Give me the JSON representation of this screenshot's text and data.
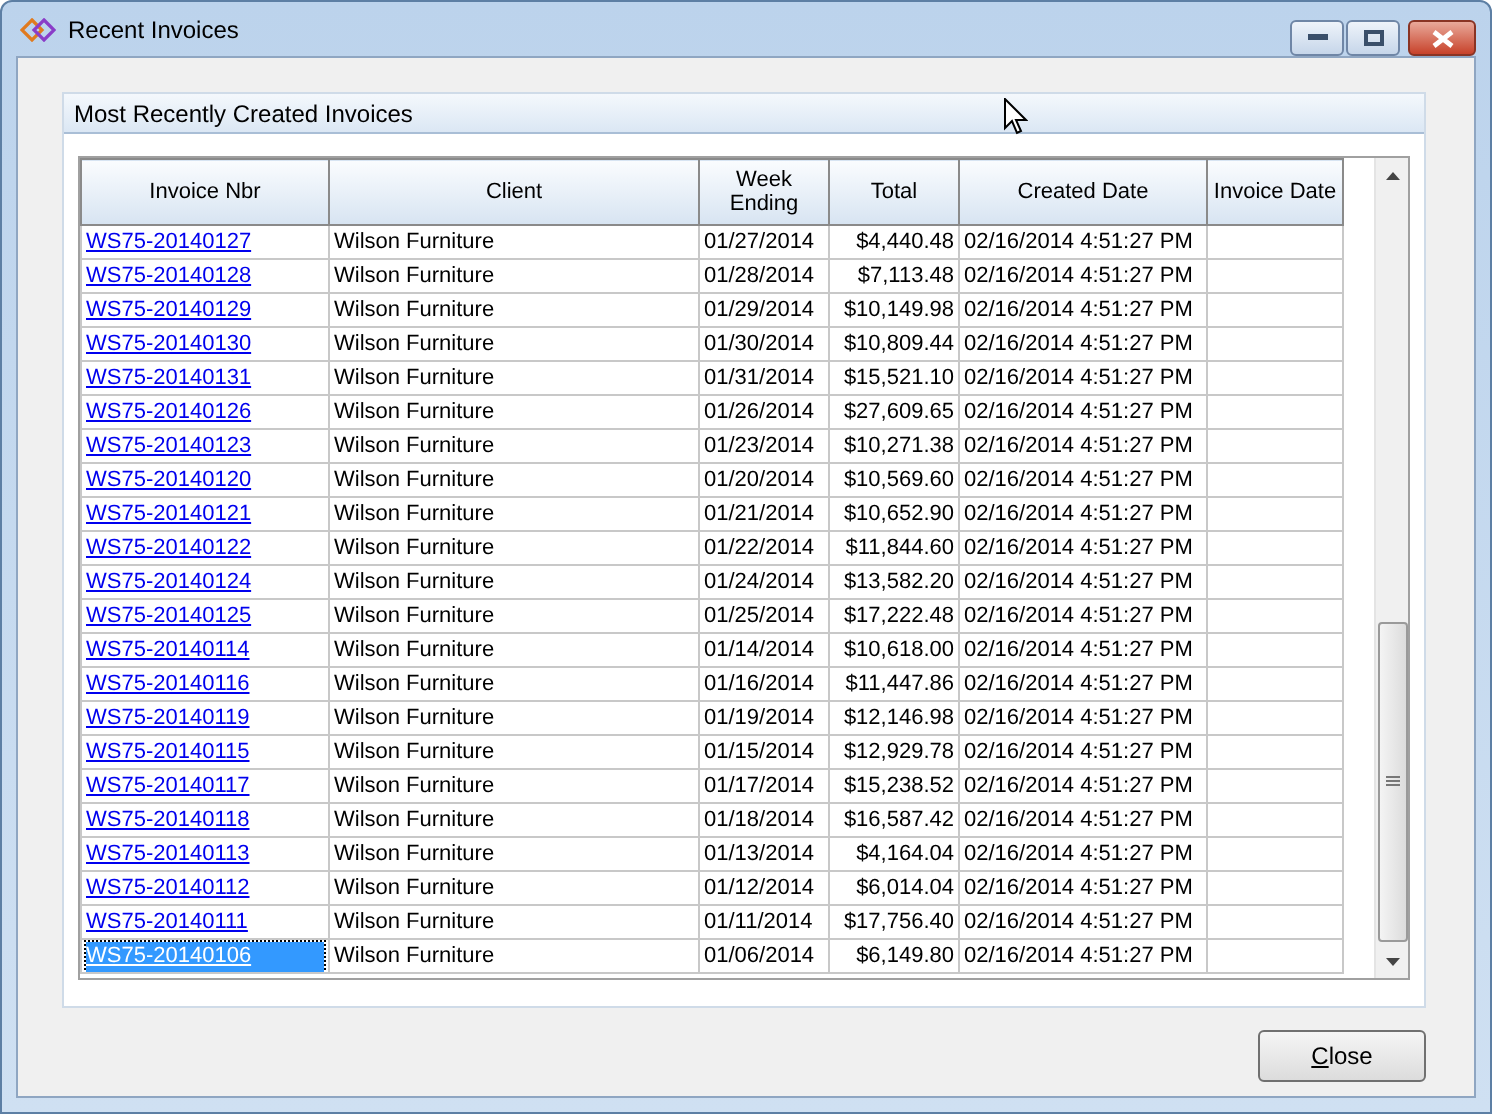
{
  "window": {
    "title": "Recent Invoices"
  },
  "panel": {
    "title": "Most Recently Created Invoices"
  },
  "table": {
    "columns": [
      "Invoice Nbr",
      "Client",
      "Week Ending",
      "Total",
      "Created Date",
      "Invoice Date"
    ],
    "rows": [
      {
        "invoice": "WS75-20140127",
        "client": "Wilson Furniture",
        "week_ending": "01/27/2014",
        "total": "$4,440.48",
        "created": "02/16/2014 4:51:27 PM",
        "selected": false
      },
      {
        "invoice": "WS75-20140128",
        "client": "Wilson Furniture",
        "week_ending": "01/28/2014",
        "total": "$7,113.48",
        "created": "02/16/2014 4:51:27 PM",
        "selected": false
      },
      {
        "invoice": "WS75-20140129",
        "client": "Wilson Furniture",
        "week_ending": "01/29/2014",
        "total": "$10,149.98",
        "created": "02/16/2014 4:51:27 PM",
        "selected": false
      },
      {
        "invoice": "WS75-20140130",
        "client": "Wilson Furniture",
        "week_ending": "01/30/2014",
        "total": "$10,809.44",
        "created": "02/16/2014 4:51:27 PM",
        "selected": false
      },
      {
        "invoice": "WS75-20140131",
        "client": "Wilson Furniture",
        "week_ending": "01/31/2014",
        "total": "$15,521.10",
        "created": "02/16/2014 4:51:27 PM",
        "selected": false
      },
      {
        "invoice": "WS75-20140126",
        "client": "Wilson Furniture",
        "week_ending": "01/26/2014",
        "total": "$27,609.65",
        "created": "02/16/2014 4:51:27 PM",
        "selected": false
      },
      {
        "invoice": "WS75-20140123",
        "client": "Wilson Furniture",
        "week_ending": "01/23/2014",
        "total": "$10,271.38",
        "created": "02/16/2014 4:51:27 PM",
        "selected": false
      },
      {
        "invoice": "WS75-20140120",
        "client": "Wilson Furniture",
        "week_ending": "01/20/2014",
        "total": "$10,569.60",
        "created": "02/16/2014 4:51:27 PM",
        "selected": false
      },
      {
        "invoice": "WS75-20140121",
        "client": "Wilson Furniture",
        "week_ending": "01/21/2014",
        "total": "$10,652.90",
        "created": "02/16/2014 4:51:27 PM",
        "selected": false
      },
      {
        "invoice": "WS75-20140122",
        "client": "Wilson Furniture",
        "week_ending": "01/22/2014",
        "total": "$11,844.60",
        "created": "02/16/2014 4:51:27 PM",
        "selected": false
      },
      {
        "invoice": "WS75-20140124",
        "client": "Wilson Furniture",
        "week_ending": "01/24/2014",
        "total": "$13,582.20",
        "created": "02/16/2014 4:51:27 PM",
        "selected": false
      },
      {
        "invoice": "WS75-20140125",
        "client": "Wilson Furniture",
        "week_ending": "01/25/2014",
        "total": "$17,222.48",
        "created": "02/16/2014 4:51:27 PM",
        "selected": false
      },
      {
        "invoice": "WS75-20140114",
        "client": "Wilson Furniture",
        "week_ending": "01/14/2014",
        "total": "$10,618.00",
        "created": "02/16/2014 4:51:27 PM",
        "selected": false
      },
      {
        "invoice": "WS75-20140116",
        "client": "Wilson Furniture",
        "week_ending": "01/16/2014",
        "total": "$11,447.86",
        "created": "02/16/2014 4:51:27 PM",
        "selected": false
      },
      {
        "invoice": "WS75-20140119",
        "client": "Wilson Furniture",
        "week_ending": "01/19/2014",
        "total": "$12,146.98",
        "created": "02/16/2014 4:51:27 PM",
        "selected": false
      },
      {
        "invoice": "WS75-20140115",
        "client": "Wilson Furniture",
        "week_ending": "01/15/2014",
        "total": "$12,929.78",
        "created": "02/16/2014 4:51:27 PM",
        "selected": false
      },
      {
        "invoice": "WS75-20140117",
        "client": "Wilson Furniture",
        "week_ending": "01/17/2014",
        "total": "$15,238.52",
        "created": "02/16/2014 4:51:27 PM",
        "selected": false
      },
      {
        "invoice": "WS75-20140118",
        "client": "Wilson Furniture",
        "week_ending": "01/18/2014",
        "total": "$16,587.42",
        "created": "02/16/2014 4:51:27 PM",
        "selected": false
      },
      {
        "invoice": "WS75-20140113",
        "client": "Wilson Furniture",
        "week_ending": "01/13/2014",
        "total": "$4,164.04",
        "created": "02/16/2014 4:51:27 PM",
        "selected": false
      },
      {
        "invoice": "WS75-20140112",
        "client": "Wilson Furniture",
        "week_ending": "01/12/2014",
        "total": "$6,014.04",
        "created": "02/16/2014 4:51:27 PM",
        "selected": false
      },
      {
        "invoice": "WS75-20140111",
        "client": "Wilson Furniture",
        "week_ending": "01/11/2014",
        "total": "$17,756.40",
        "created": "02/16/2014 4:51:27 PM",
        "selected": false
      },
      {
        "invoice": "WS75-20140106",
        "client": "Wilson Furniture",
        "week_ending": "01/06/2014",
        "total": "$6,149.80",
        "created": "02/16/2014 4:51:27 PM",
        "selected": true
      }
    ]
  },
  "buttons": [
    {
      "label": "Close",
      "access_key_underlined": true
    }
  ]
}
